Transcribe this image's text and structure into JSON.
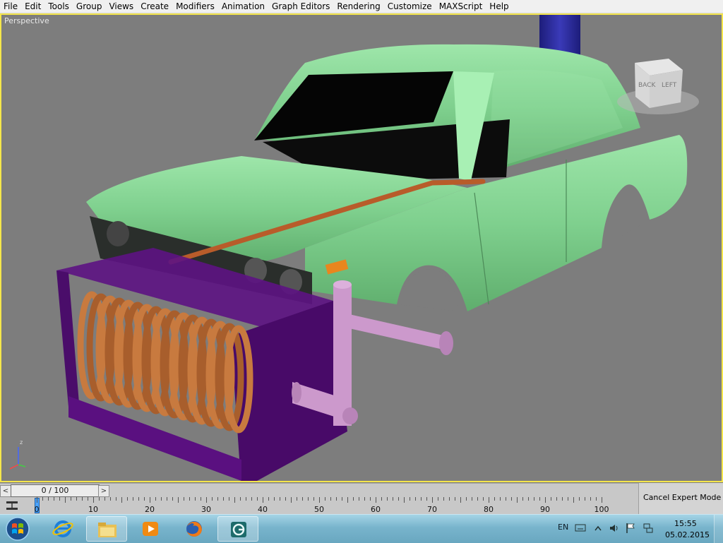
{
  "menu": [
    "File",
    "Edit",
    "Tools",
    "Group",
    "Views",
    "Create",
    "Modifiers",
    "Animation",
    "Graph Editors",
    "Rendering",
    "Customize",
    "MAXScript",
    "Help"
  ],
  "viewport": {
    "label": "Perspective",
    "viewcube": {
      "back": "BACK",
      "left": "LEFT"
    },
    "axis": {
      "z": "z",
      "x": "x",
      "y": "y"
    }
  },
  "timeslider": {
    "frame_text": "0 / 100",
    "prev": "<",
    "next": ">"
  },
  "trackbar": {
    "ticks": [
      "0",
      "10",
      "20",
      "30",
      "40",
      "50",
      "60",
      "70",
      "80",
      "90",
      "100"
    ]
  },
  "expert_mode": {
    "label": "Cancel Expert Mode"
  },
  "taskbar": {
    "apps": [
      "start-orb",
      "internet-explorer",
      "file-explorer",
      "media-player",
      "firefox",
      "3ds-max"
    ],
    "tray": {
      "language": "EN",
      "time": "15:55",
      "date": "05.02.2015"
    }
  },
  "colors": {
    "viewport_bg": "#7d7d7d",
    "viewport_border": "#f5e64b",
    "car_body": "#7fd08e",
    "winch_frame": "#4f0a6e",
    "coil": "#c87a3f",
    "pipe": "#cc99cc",
    "column": "#2c2c9e"
  }
}
